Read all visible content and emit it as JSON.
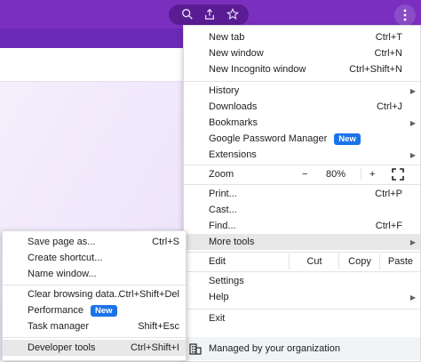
{
  "toolbar": {
    "icons": [
      "search-icon",
      "share-icon",
      "star-icon",
      "kebab-menu-icon"
    ]
  },
  "menu": {
    "new_tab": {
      "label": "New tab",
      "shortcut": "Ctrl+T"
    },
    "new_window": {
      "label": "New window",
      "shortcut": "Ctrl+N"
    },
    "new_incognito": {
      "label": "New Incognito window",
      "shortcut": "Ctrl+Shift+N"
    },
    "history": {
      "label": "History"
    },
    "downloads": {
      "label": "Downloads",
      "shortcut": "Ctrl+J"
    },
    "bookmarks": {
      "label": "Bookmarks"
    },
    "password_manager": {
      "label": "Google Password Manager",
      "badge": "New"
    },
    "extensions": {
      "label": "Extensions"
    },
    "zoom": {
      "label": "Zoom",
      "minus": "−",
      "level": "80%",
      "plus": "+"
    },
    "print": {
      "label": "Print...",
      "shortcut": "Ctrl+P"
    },
    "cast": {
      "label": "Cast..."
    },
    "find": {
      "label": "Find...",
      "shortcut": "Ctrl+F"
    },
    "more_tools": {
      "label": "More tools"
    },
    "edit": {
      "label": "Edit",
      "cut": "Cut",
      "copy": "Copy",
      "paste": "Paste"
    },
    "settings": {
      "label": "Settings"
    },
    "help": {
      "label": "Help"
    },
    "exit": {
      "label": "Exit"
    },
    "managed": {
      "label": "Managed by your organization"
    }
  },
  "submenu": {
    "save_page": {
      "label": "Save page as...",
      "shortcut": "Ctrl+S"
    },
    "create_shortcut": {
      "label": "Create shortcut..."
    },
    "name_window": {
      "label": "Name window..."
    },
    "clear_browsing": {
      "label": "Clear browsing data...",
      "shortcut": "Ctrl+Shift+Del"
    },
    "performance": {
      "label": "Performance",
      "badge": "New"
    },
    "task_manager": {
      "label": "Task manager",
      "shortcut": "Shift+Esc"
    },
    "developer_tools": {
      "label": "Developer tools",
      "shortcut": "Ctrl+Shift+I"
    }
  },
  "colors": {
    "accent": "#7b2fbf",
    "badge": "#1a73e8",
    "highlight": "#e8e8e8"
  }
}
